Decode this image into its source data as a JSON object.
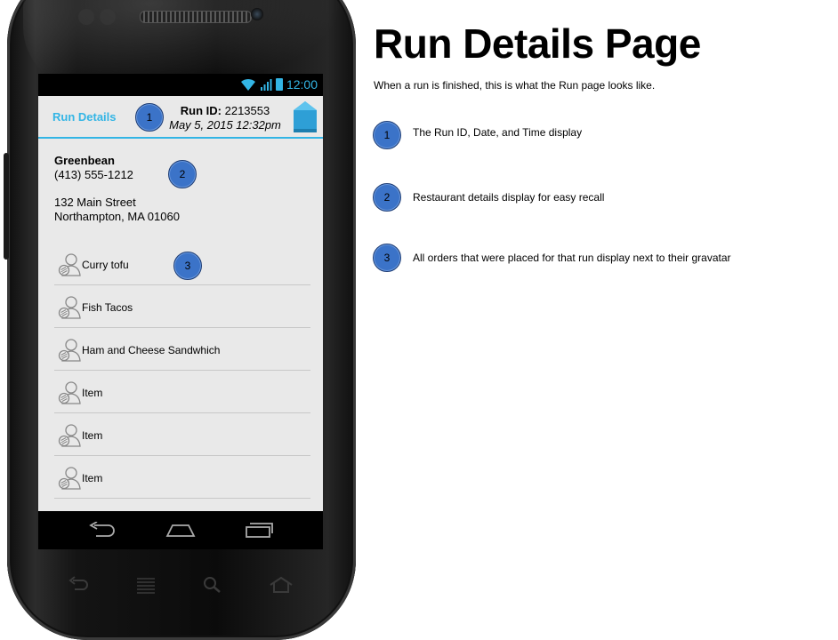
{
  "page": {
    "title": "Run Details Page",
    "intro": "When a run is finished, this is what the Run page looks like."
  },
  "device": {
    "clock": "12:00"
  },
  "app": {
    "action_title": "Run Details",
    "run_id_label": "Run ID:",
    "run_id_value": "2213553",
    "run_datetime": "May 5, 2015 12:32pm",
    "restaurant": {
      "name": "Greenbean",
      "phone": "(413) 555-1212",
      "street": "132 Main Street",
      "city": "Northampton, MA 01060"
    },
    "orders": [
      {
        "label": "Curry tofu"
      },
      {
        "label": "Fish Tacos"
      },
      {
        "label": "Ham and Cheese Sandwhich"
      },
      {
        "label": "Item"
      },
      {
        "label": "Item"
      },
      {
        "label": "Item"
      }
    ]
  },
  "callouts": [
    {
      "num": "1",
      "text": "The Run ID, Date, and Time display"
    },
    {
      "num": "2",
      "text": "Restaurant details display for easy recall"
    },
    {
      "num": "3",
      "text": "All orders that were placed for that run display next to their gravatar"
    }
  ],
  "colors": {
    "accent": "#33b5e5",
    "badge": "#3b73c8"
  }
}
